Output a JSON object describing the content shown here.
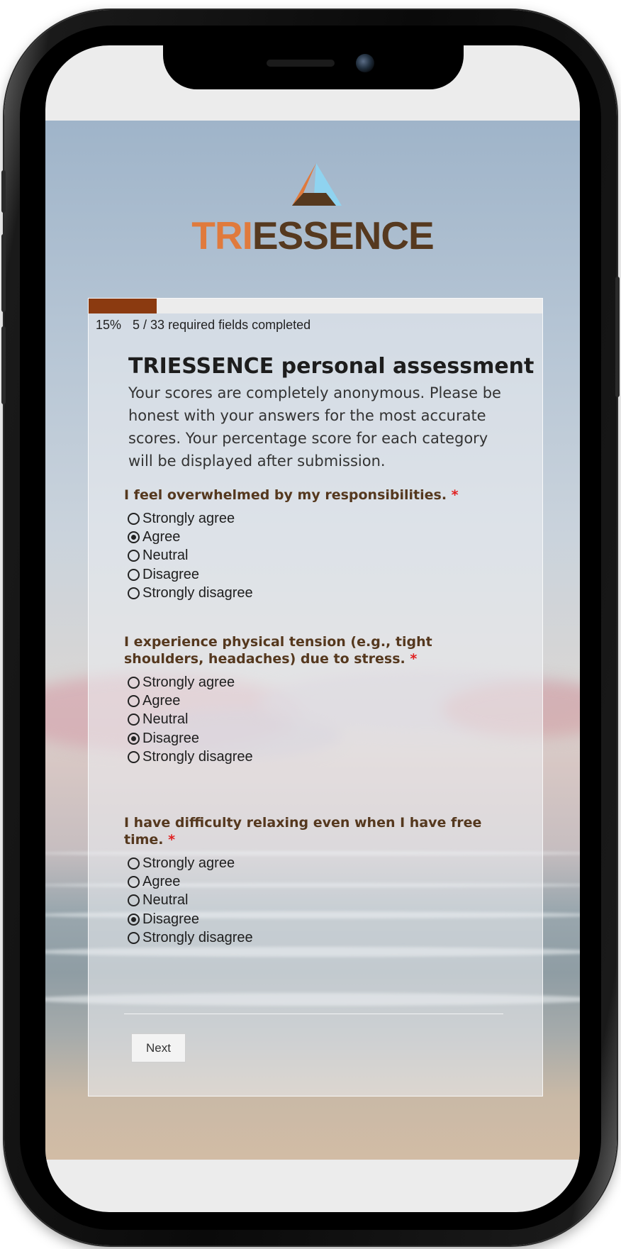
{
  "brand": {
    "logo_tri": "TRI",
    "logo_essence": "ESSENCE",
    "colors": {
      "orange": "#e07a3c",
      "brown": "#56391f",
      "light_blue": "#8fd3f0"
    }
  },
  "progress": {
    "percent_label": "15%",
    "status_text": "5 / 33 required fields completed",
    "fraction": 0.15,
    "bar_color": "#8b3a10"
  },
  "form": {
    "title": "TRIESSENCE personal assessment",
    "description": "Your scores are completely anonymous. Please be honest with your answers for the most accurate scores. Your percentage score for each category will be displayed after submission."
  },
  "questions": [
    {
      "text": "I feel overwhelmed by my responsibilities.",
      "required_mark": "*",
      "options": [
        "Strongly agree",
        "Agree",
        "Neutral",
        "Disagree",
        "Strongly disagree"
      ],
      "selected": "Agree"
    },
    {
      "text": "I experience physical tension (e.g., tight shoulders, headaches) due to stress.",
      "required_mark": "*",
      "options": [
        "Strongly agree",
        "Agree",
        "Neutral",
        "Disagree",
        "Strongly disagree"
      ],
      "selected": "Disagree"
    },
    {
      "text": "I have difficulty relaxing even when I have free time.",
      "required_mark": "*",
      "options": [
        "Strongly agree",
        "Agree",
        "Neutral",
        "Disagree",
        "Strongly disagree"
      ],
      "selected": "Disagree"
    }
  ],
  "actions": {
    "next_label": "Next"
  }
}
